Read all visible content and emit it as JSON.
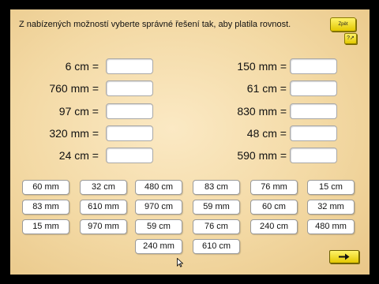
{
  "instruction": "Z nabízených možností vyberte správné řešení tak, aby platila rovnost.",
  "buttons": {
    "back": "Zpět",
    "help": "?↗",
    "next_icon": "arrow-right-icon"
  },
  "equations_left": [
    "6 cm =",
    "760 mm =",
    "97 cm =",
    "320 mm =",
    "24 cm ="
  ],
  "equations_right": [
    "150 mm =",
    "61 cm =",
    "830 mm =",
    "48 cm =",
    "590 mm ="
  ],
  "answers": [
    "60 mm",
    "32 cm",
    "480 cm",
    "83 cm",
    "76 mm",
    "15 cm",
    "83 mm",
    "610 mm",
    "970 cm",
    "59 mm",
    "60 cm",
    "32 mm",
    "15 mm",
    "970 mm",
    "59 cm",
    "76 cm",
    "240 cm",
    "480 mm",
    "240 mm",
    "610 cm"
  ],
  "colors": {
    "background": "#f3d9a4",
    "button_yellow": "#f2dd1a"
  }
}
